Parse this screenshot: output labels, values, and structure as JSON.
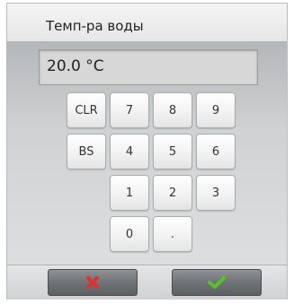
{
  "dialog": {
    "title": "Темп-ра воды",
    "display_value": "20.0 °C"
  },
  "keypad": {
    "clear": "CLR",
    "backspace": "BS",
    "keys": [
      "7",
      "8",
      "9",
      "4",
      "5",
      "6",
      "1",
      "2",
      "3",
      "0",
      "."
    ]
  },
  "actions": {
    "cancel_icon": "cross-icon",
    "confirm_icon": "checkmark-icon",
    "cancel_color": "#e03030",
    "confirm_color": "#5cc02c"
  }
}
